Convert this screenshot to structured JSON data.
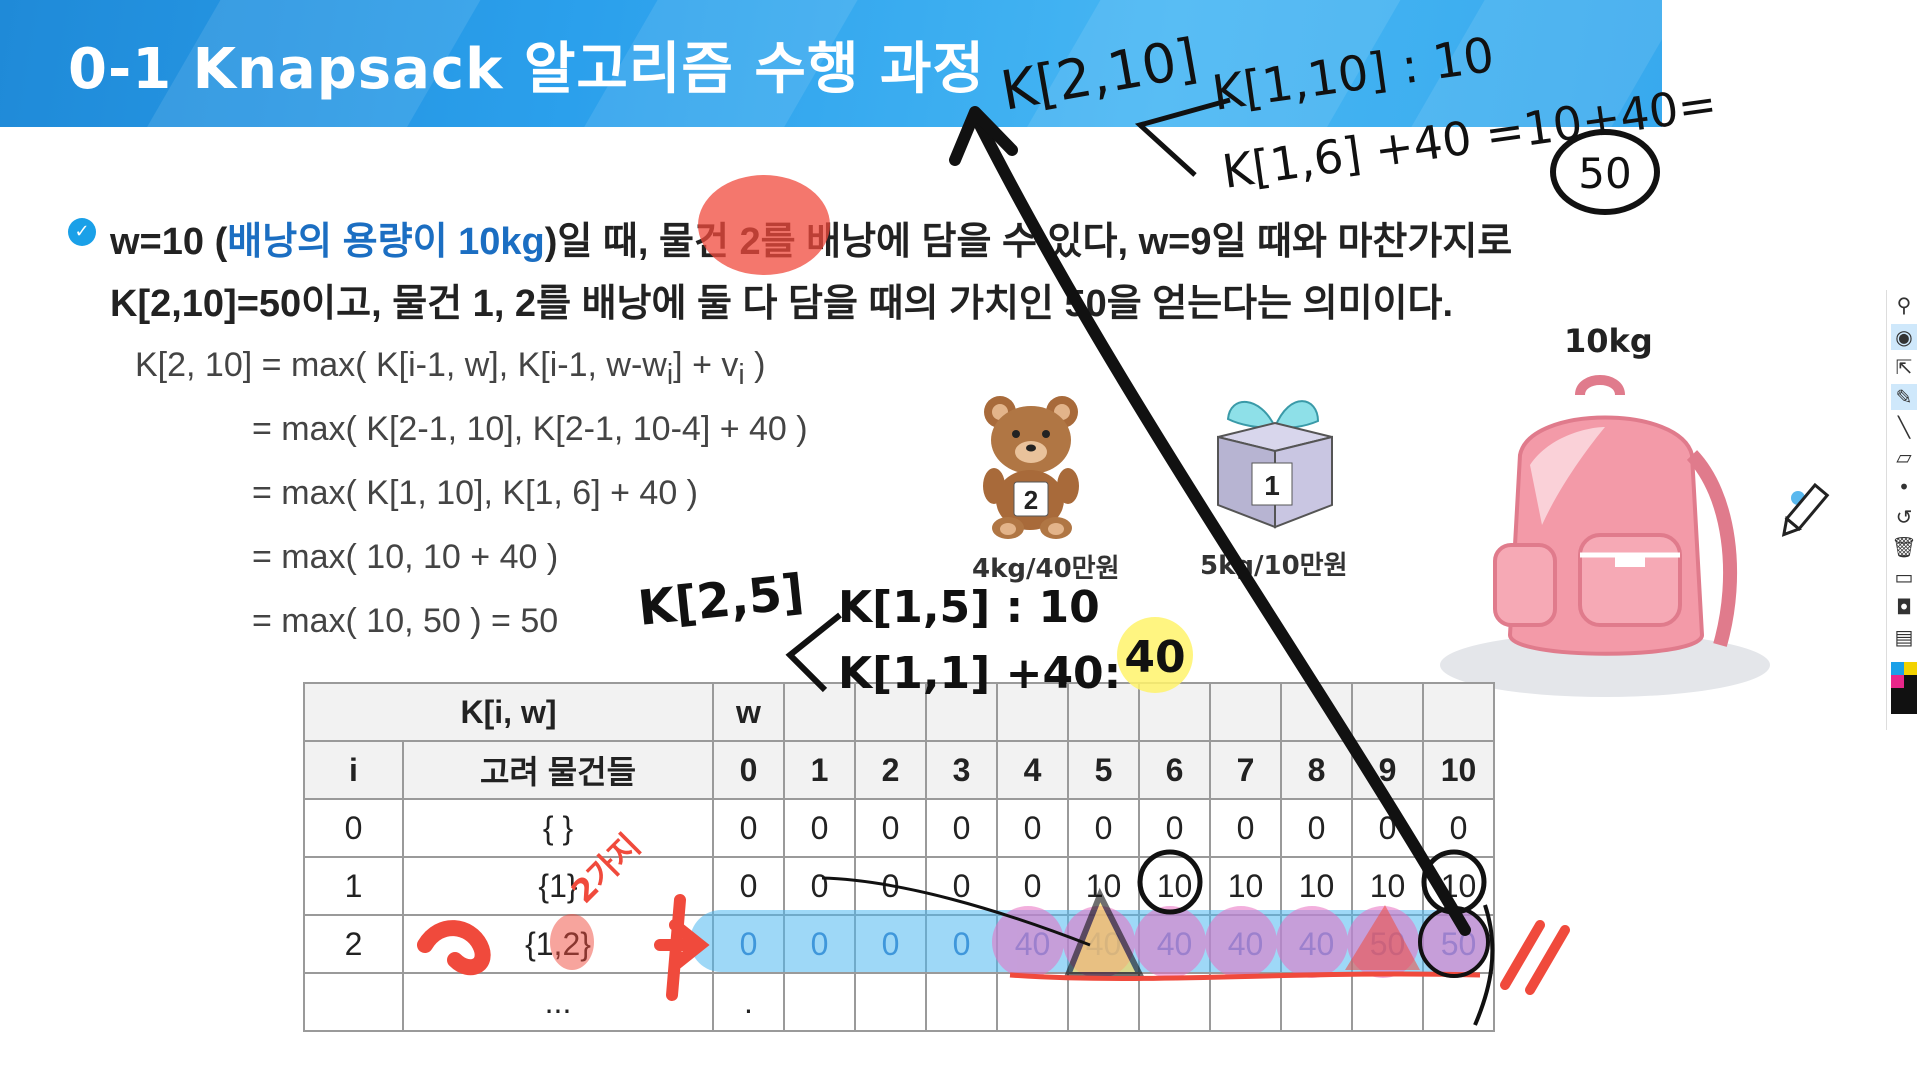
{
  "slide": {
    "title": "0-1 Knapsack 알고리즘 수행 과정",
    "bullet_icon": "check-circle-icon",
    "line1": {
      "a": "w=10 (",
      "b": "배낭의 용량이 10kg",
      "c": ")일 때, 물건 2를 배낭에 담을 수 있다, w=9일 때와 마찬가지로"
    },
    "line2": "K[2,10]=50이고, 물건 1, 2를 배낭에 둘 다 담을 때의 가치인 50을 얻는다는 의미이다.",
    "formula": {
      "l1_pre": "K[2, 10] = max( K[i-1, w], K[i-1, w-w",
      "l1_sub1": "i",
      "l1_mid": "] + v",
      "l1_sub2": "i",
      "l1_post": " )",
      "l2": "= max( K[2-1, 10], K[2-1, 10-4] + 40 )",
      "l3": "= max( K[1, 10], K[1, 6] + 40 )",
      "l4": "= max( 10, 10 + 40 )",
      "l5": "= max( 10, 50 ) = 50"
    },
    "items": {
      "bear_number": "2",
      "bear_label": "4kg/40만원",
      "gift_number": "1",
      "gift_label": "5kg/10만원"
    },
    "backpack_label": "10kg"
  },
  "table": {
    "header_top": {
      "ki": "K[i, w]",
      "w": "w"
    },
    "header": {
      "i": "i",
      "set": "고려 물건들",
      "cols": [
        "0",
        "1",
        "2",
        "3",
        "4",
        "5",
        "6",
        "7",
        "8",
        "9",
        "10"
      ]
    },
    "rows": [
      {
        "i": "0",
        "set": "{ }",
        "values": [
          "0",
          "0",
          "0",
          "0",
          "0",
          "0",
          "0",
          "0",
          "0",
          "0",
          "0"
        ]
      },
      {
        "i": "1",
        "set": "{1}",
        "values": [
          "0",
          "0",
          "0",
          "0",
          "0",
          "10",
          "10",
          "10",
          "10",
          "10",
          "10"
        ]
      },
      {
        "i": "2",
        "set": "{1,2}",
        "values": [
          "0",
          "0",
          "0",
          "0",
          "40",
          "40",
          "40",
          "40",
          "40",
          "50",
          "50"
        ]
      },
      {
        "i": "",
        "set": "...",
        "values": [
          ".",
          "",
          "",
          "",
          "",
          "",
          "",
          "",
          "",
          "",
          ""
        ]
      }
    ]
  },
  "annotations": {
    "top_a": "K[2,10]",
    "top_b": "K[1,10] : 10",
    "top_c": "K[1,6] +40 =10+40=",
    "top_circled": "50",
    "mid_a": "K[2,5]",
    "mid_b": "K[1,5] : 10",
    "mid_c": "K[1,1] +40:",
    "mid_highlight": "40",
    "red_side": "2가지"
  },
  "colors": {
    "banner": "#2ba0ec",
    "accent_blue": "#1b6ec2",
    "highlight_blue": "#4fb8f0",
    "highlight_pink": "#e86fc2",
    "ink_red": "#f04a3c",
    "marker_yellow": "#fff36b"
  },
  "toolbar": {
    "icons": [
      "pin-icon",
      "eye-icon",
      "pointer-icon",
      "pen-icon",
      "line-icon",
      "eraser-icon",
      "dot-icon",
      "undo-icon",
      "trash-icon",
      "monitor-icon",
      "camera-icon",
      "clipboard-icon",
      "color-palette-icon"
    ]
  }
}
